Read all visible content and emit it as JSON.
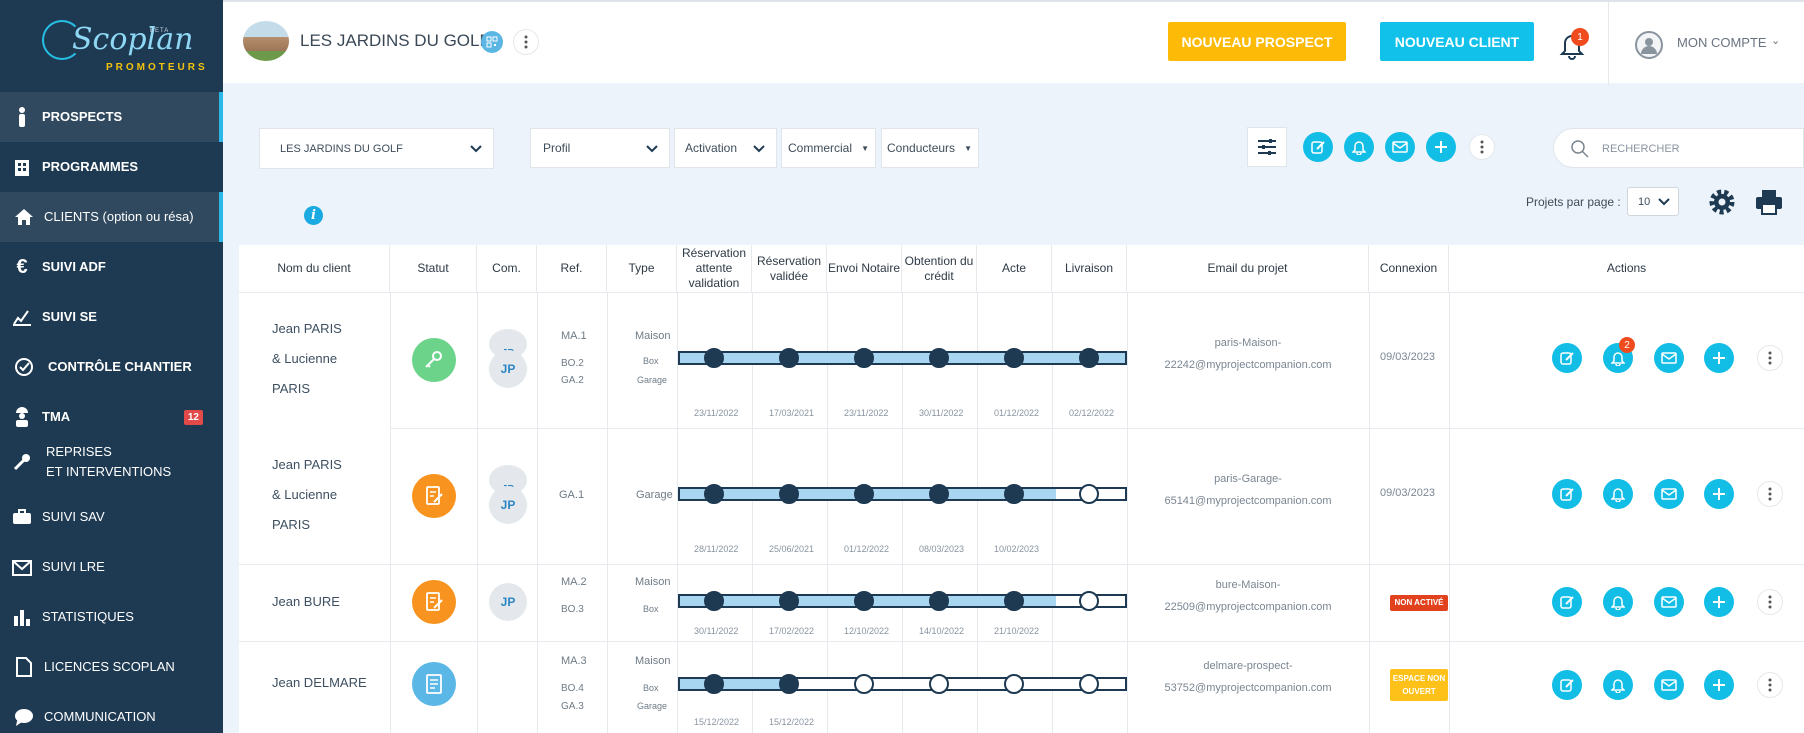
{
  "brand": {
    "name": "Scoplan",
    "beta": "BETA",
    "subtitle": "PROMOTEURS"
  },
  "sidebar": {
    "items": [
      {
        "label": "PROSPECTS",
        "icon": "person-icon",
        "active": true
      },
      {
        "label": "PROGRAMMES",
        "icon": "building-icon"
      },
      {
        "label": "CLIENTS (option ou résa)",
        "icon": "home-icon",
        "active": true
      },
      {
        "label": "SUIVI ADF",
        "icon": "euro-icon"
      },
      {
        "label": "SUIVI SE",
        "icon": "signature-icon"
      },
      {
        "label": "CONTRÔLE CHANTIER",
        "icon": "check-circle-icon"
      },
      {
        "label": "TMA",
        "icon": "worker-icon",
        "count": "12"
      },
      {
        "label": "REPRISES",
        "label2": "ET INTERVENTIONS",
        "icon": "wrench-icon"
      },
      {
        "label": "SUIVI SAV",
        "icon": "toolbox-icon"
      },
      {
        "label": "SUIVI LRE",
        "icon": "mail-check-icon"
      },
      {
        "label": "STATISTIQUES",
        "icon": "bar-chart-icon"
      },
      {
        "label": "LICENCES SCOPLAN",
        "icon": "document-icon"
      },
      {
        "label": "COMMUNICATION",
        "icon": "chat-icon"
      }
    ]
  },
  "header": {
    "project_title": "LES JARDINS DU GOLF",
    "new_prospect": "NOUVEAU PROSPECT",
    "new_client": "NOUVEAU CLIENT",
    "bell_count": "1",
    "account": "MON COMPTE"
  },
  "filters": {
    "programme": "LES JARDINS DU GOLF",
    "profil": "Profil",
    "activation": "Activation",
    "commercial": "Commercial",
    "conducteurs": "Conducteurs",
    "search_placeholder": "RECHERCHER",
    "per_page_label": "Projets par page :",
    "per_page_value": "10"
  },
  "table": {
    "headers": [
      "Nom du client",
      "Statut",
      "Com.",
      "Ref.",
      "Type",
      "Réservation attente validation",
      "Réservation validée",
      "Envoi Notaire",
      "Obtention du crédit",
      "Acte",
      "Livraison",
      "Email du projet",
      "Connexion",
      "Actions"
    ],
    "rows": [
      {
        "name1": "Jean PARIS",
        "name2": "& Lucienne",
        "name3": "PARIS",
        "statut": "keys",
        "avatar1": "JP",
        "avatar2": "JP",
        "refs": [
          "MA.1",
          "BO.2",
          "GA.2"
        ],
        "types": [
          "Maison",
          "Box",
          "Garage"
        ],
        "steps_done": 6,
        "dates": [
          "23/11/2022",
          "17/03/2021",
          "23/11/2022",
          "30/11/2022",
          "01/12/2022",
          "02/12/2022"
        ],
        "email1": "paris-Maison-",
        "email2": "22242@myprojectcompanion.com",
        "connexion": "09/03/2023",
        "bell_badge": "2"
      },
      {
        "name1": "Jean PARIS",
        "name2": "& Lucienne",
        "name3": "PARIS",
        "statut": "contract",
        "avatar1": "JP",
        "avatar2": "JP",
        "refs": [
          "GA.1"
        ],
        "types": [
          "Garage"
        ],
        "steps_done": 5,
        "dates": [
          "28/11/2022",
          "25/06/2021",
          "01/12/2022",
          "08/03/2023",
          "10/02/2023",
          ""
        ],
        "email1": "paris-Garage-",
        "email2": "65141@myprojectcompanion.com",
        "connexion": "09/03/2023"
      },
      {
        "name1": "Jean BURE",
        "statut": "contract",
        "avatar1": "JP",
        "refs": [
          "MA.2",
          "BO.3"
        ],
        "types": [
          "Maison",
          "Box"
        ],
        "steps_done": 5,
        "dates": [
          "30/11/2022",
          "17/02/2022",
          "12/10/2022",
          "14/10/2022",
          "21/10/2022",
          ""
        ],
        "email1": "bure-Maison-",
        "email2": "22509@myprojectcompanion.com",
        "connexion_badge": "NON ACTIVÉ"
      },
      {
        "name1": "Jean DELMARE",
        "statut": "form",
        "refs": [
          "MA.3",
          "BO.4",
          "GA.3"
        ],
        "types": [
          "Maison",
          "Box",
          "Garage"
        ],
        "steps_done": 2,
        "dates": [
          "15/12/2022",
          "15/12/2022",
          "",
          "",
          "",
          ""
        ],
        "email1": "delmare-prospect-",
        "email2": "53752@myprojectcompanion.com",
        "connexion_badge1": "ESPACE NON",
        "connexion_badge2": "OUVERT"
      }
    ]
  },
  "colors": {
    "sidebar": "#1e3a52",
    "accent": "#12bde6",
    "yellow": "#fdbb08",
    "green": "#6cd48a",
    "orange": "#f7931e",
    "blue": "#5bb8e6"
  }
}
